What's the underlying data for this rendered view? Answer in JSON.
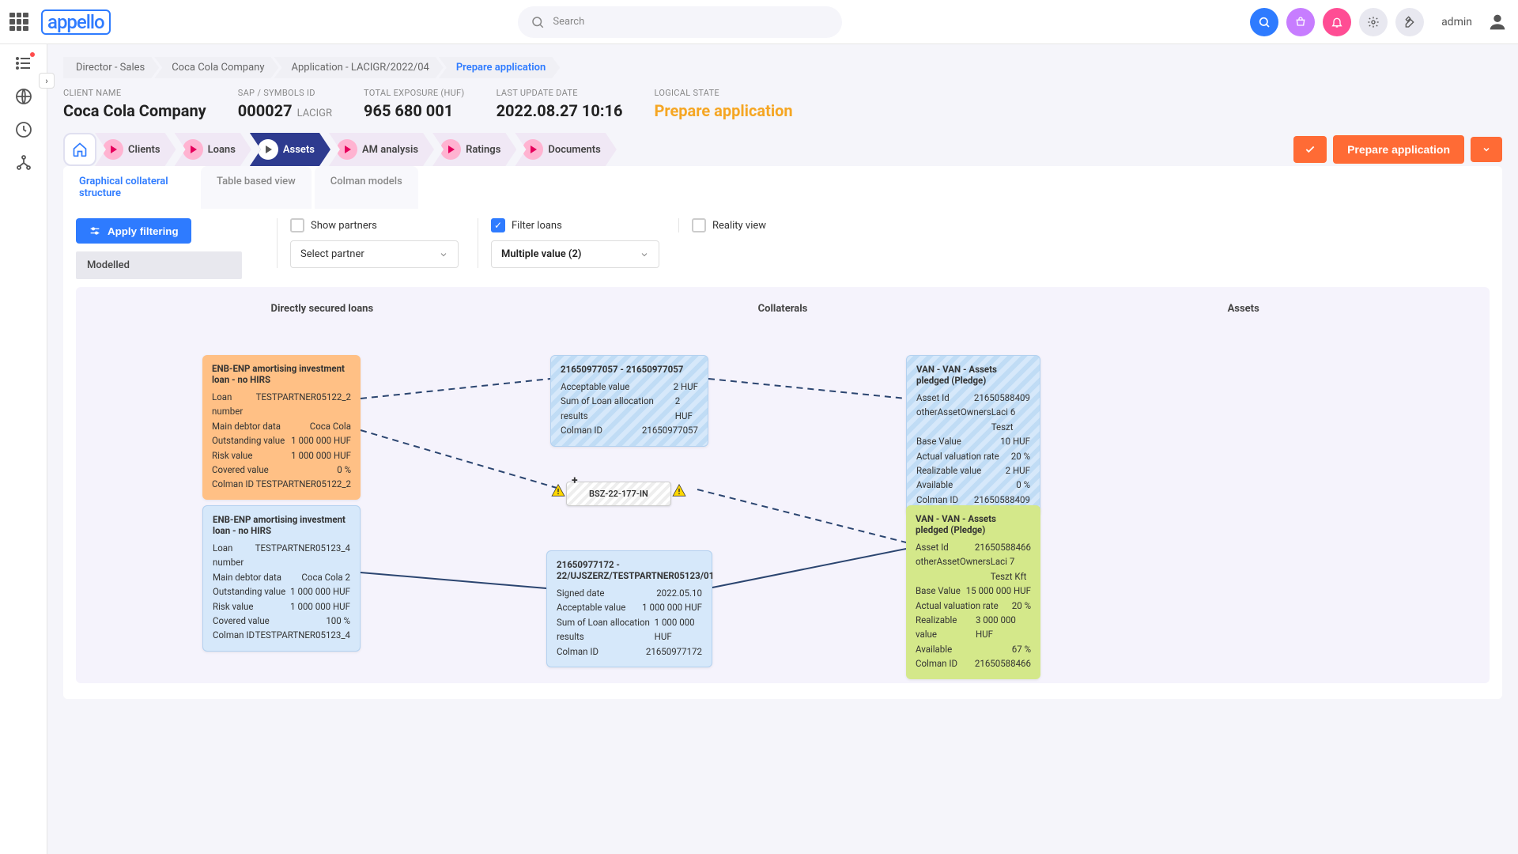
{
  "header": {
    "search_placeholder": "Search",
    "admin_label": "admin"
  },
  "breadcrumb": {
    "items": [
      {
        "label": "Director - Sales"
      },
      {
        "label": "Coca Cola Company"
      },
      {
        "label": "Application - LACIGR/2022/04"
      },
      {
        "label": "Prepare application"
      }
    ]
  },
  "info": {
    "client_name_label": "CLIENT NAME",
    "client_name": "Coca Cola Company",
    "sap_label": "SAP / SYMBOLS ID",
    "sap_id": "000027",
    "sap_suffix": "LACIGR",
    "exposure_label": "TOTAL EXPOSURE (HUF)",
    "exposure": "965 680 001",
    "last_update_label": "LAST UPDATE DATE",
    "last_update": "2022.08.27 10:16",
    "logical_state_label": "LOGICAL STATE",
    "logical_state": "Prepare application"
  },
  "nav": {
    "items": [
      "Clients",
      "Loans",
      "Assets",
      "AM analysis",
      "Ratings",
      "Documents"
    ],
    "prepare_btn": "Prepare application"
  },
  "tabs": {
    "items": [
      "Graphical collateral structure",
      "Table based view",
      "Colman models"
    ]
  },
  "filters": {
    "apply": "Apply filtering",
    "modelled": "Modelled",
    "show_partners": "Show partners",
    "select_partner": "Select partner",
    "filter_loans": "Filter loans",
    "multiple_value": "Multiple value (2)",
    "reality_view": "Reality view"
  },
  "graph": {
    "headers": [
      "Directly secured loans",
      "Collaterals",
      "Assets"
    ],
    "loan1": {
      "title": "ENB-ENP amortising investment loan - no HIRS",
      "rows": [
        [
          "Loan number",
          "TESTPARTNER05122_2"
        ],
        [
          "Main debtor data",
          "Coca Cola"
        ],
        [
          "Outstanding value",
          "1 000 000 HUF"
        ],
        [
          "Risk value",
          "1 000 000 HUF"
        ],
        [
          "Covered value",
          "0 %"
        ],
        [
          "Colman ID",
          "TESTPARTNER05122_2"
        ]
      ]
    },
    "loan2": {
      "title": "ENB-ENP amortising investment loan - no HIRS",
      "rows": [
        [
          "Loan number",
          "TESTPARTNER05123_4"
        ],
        [
          "Main debtor data",
          "Coca Cola 2"
        ],
        [
          "Outstanding value",
          "1 000 000 HUF"
        ],
        [
          "Risk value",
          "1 000 000 HUF"
        ],
        [
          "Covered value",
          "100 %"
        ],
        [
          "Colman ID",
          "TESTPARTNER05123_4"
        ]
      ]
    },
    "coll1": {
      "title": "21650977057 - 21650977057",
      "rows": [
        [
          "Acceptable value",
          "2 HUF"
        ],
        [
          "Sum of Loan allocation results",
          "2 HUF"
        ],
        [
          "Colman ID",
          "21650977057"
        ]
      ]
    },
    "coll2": {
      "title": "21650977172 - 22/UJSZERZ/TESTPARTNER05123/01",
      "rows": [
        [
          "Signed date",
          "2022.05.10"
        ],
        [
          "Acceptable value",
          "1 000 000 HUF"
        ],
        [
          "Sum of Loan allocation results",
          "1 000 000 HUF"
        ],
        [
          "Colman ID",
          "21650977172"
        ]
      ]
    },
    "asset1": {
      "title": "VAN - VAN - Assets pledged (Pledge)",
      "rows": [
        [
          "Asset Id",
          "21650588409"
        ],
        [
          "otherAssetOwners",
          "Laci 6 Teszt"
        ],
        [
          "Base Value",
          "10 HUF"
        ],
        [
          "Actual valuation rate",
          "20 %"
        ],
        [
          "Realizable value",
          "2 HUF"
        ],
        [
          "Available",
          "0 %"
        ],
        [
          "Colman ID",
          "21650588409"
        ]
      ]
    },
    "asset2": {
      "title": "VAN - VAN - Assets pledged (Pledge)",
      "rows": [
        [
          "Asset Id",
          "21650588466"
        ],
        [
          "otherAssetOwners",
          "Laci 7 Teszt Kft"
        ],
        [
          "Base Value",
          "15 000 000 HUF"
        ],
        [
          "Actual valuation rate",
          "20 %"
        ],
        [
          "Realizable value",
          "3 000 000 HUF"
        ],
        [
          "Available",
          "67 %"
        ],
        [
          "Colman ID",
          "21650588466"
        ]
      ]
    },
    "node": "BSZ-22-177-IN"
  }
}
